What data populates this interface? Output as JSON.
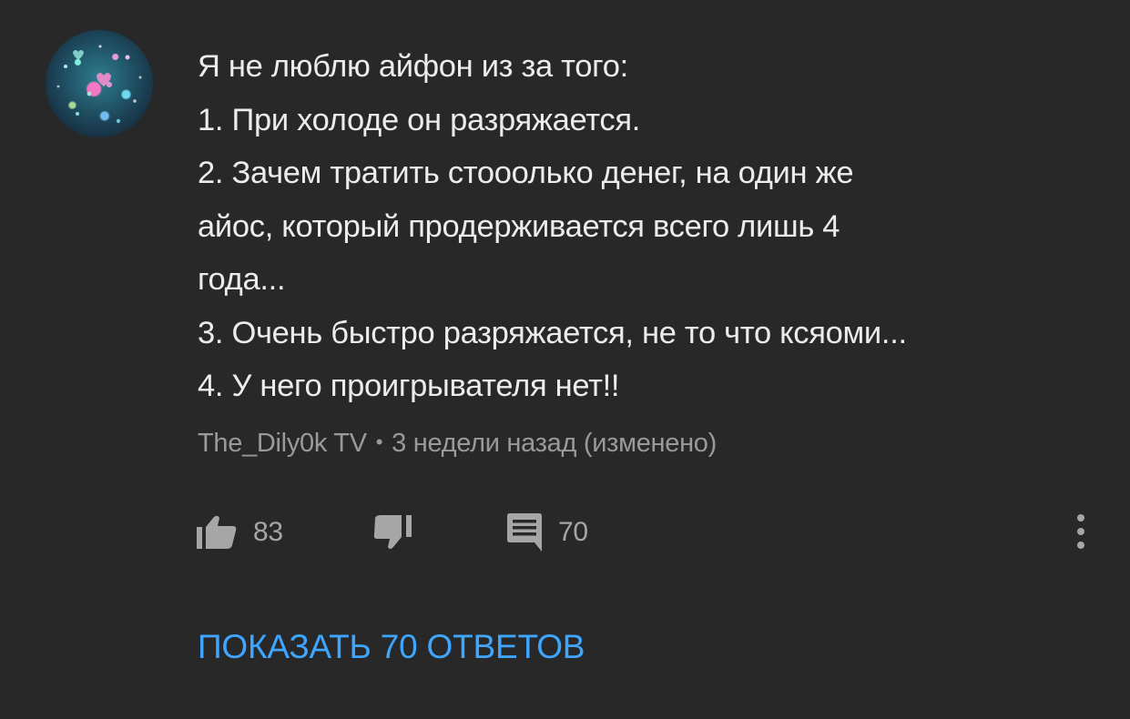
{
  "comment": {
    "lines": [
      "Я не люблю айфон из за того:",
      "1. При холоде он разряжается.",
      "2. Зачем тратить стооолько денег, на один же",
      "айос, который продерживается всего лишь 4",
      "года...",
      "3. Очень быстро разряжается, не то что ксяоми...",
      "4. У него проигрывателя нет!!"
    ],
    "author": "The_Dily0k TV",
    "separator": "•",
    "timestamp": "3 недели назад (изменено)"
  },
  "actions": {
    "like_count": "83",
    "reply_count": "70"
  },
  "show_replies_label": "ПОКАЗАТЬ 70 ОТВЕТОВ",
  "colors": {
    "background": "#282828",
    "text": "#ececec",
    "meta": "#9a9a9a",
    "link": "#3ea6ff"
  },
  "icons": {
    "like": "thumbs-up-icon",
    "dislike": "thumbs-down-icon",
    "reply": "comment-icon",
    "more": "more-vertical-icon"
  }
}
